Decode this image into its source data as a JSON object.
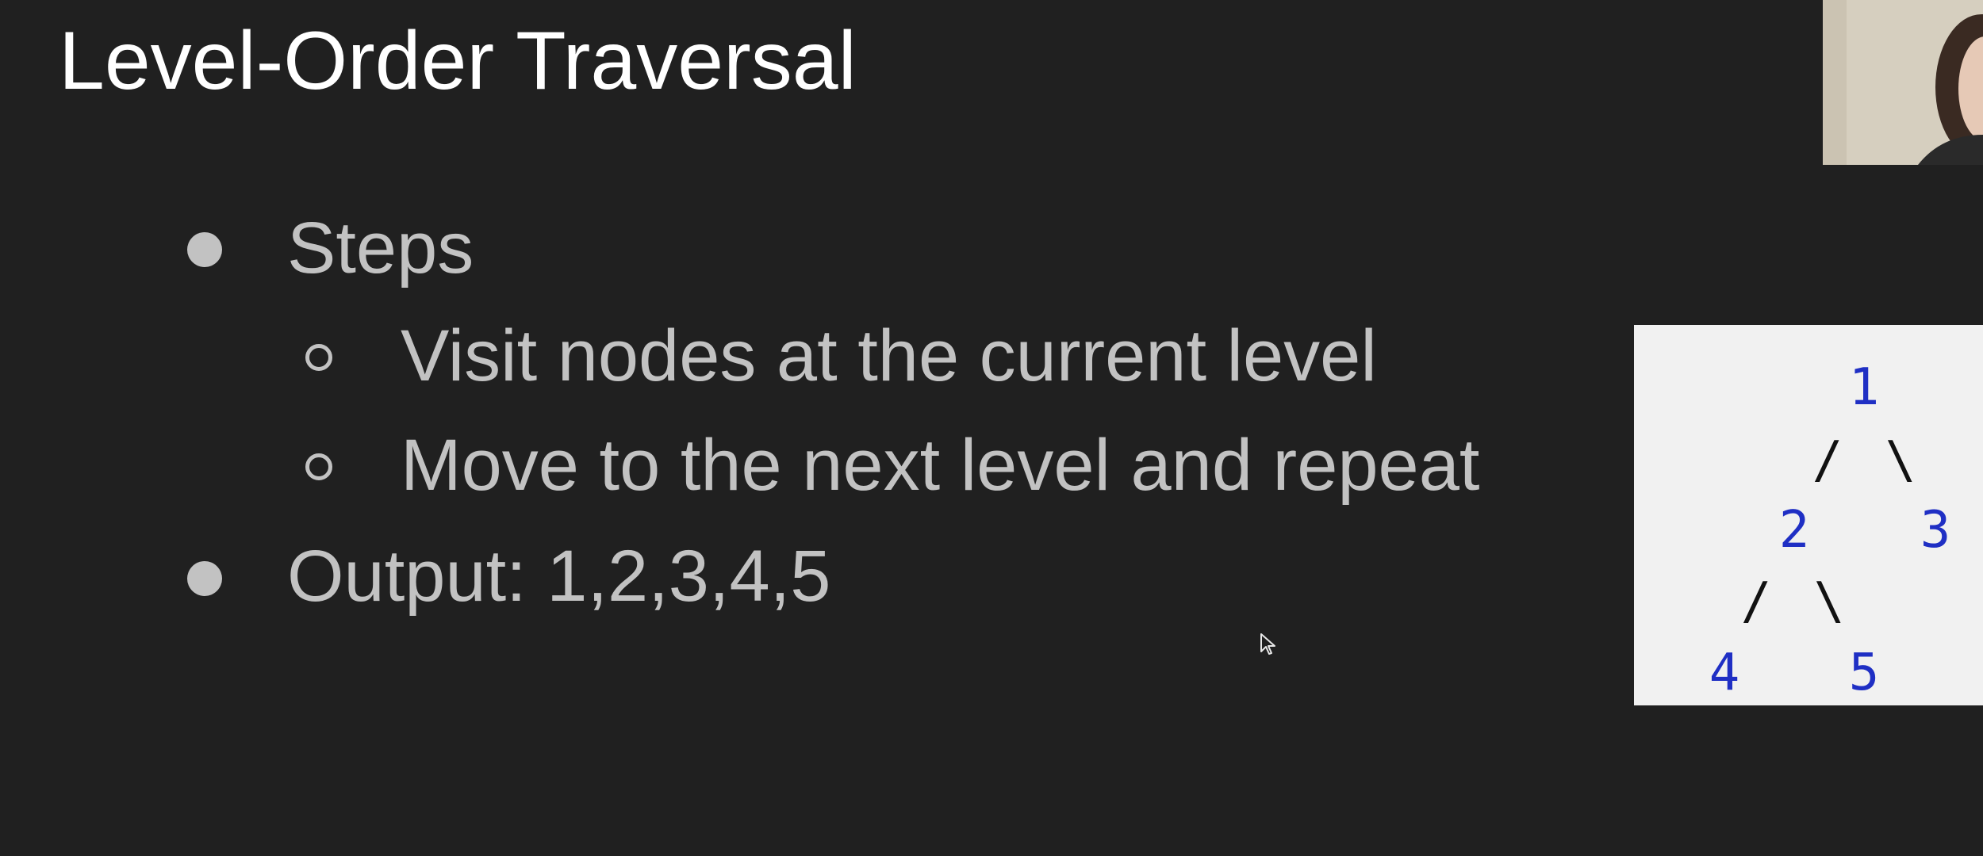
{
  "slide": {
    "title": "Level-Order Traversal",
    "bullets": [
      {
        "text": "Steps",
        "sub_bullets": [
          "Visit nodes at the current level",
          "Move to the next level and repeat"
        ]
      },
      {
        "text": "Output: 1,2,3,4,5"
      }
    ]
  },
  "tree_diagram": {
    "nodes": [
      "1",
      "2",
      "3",
      "4",
      "5"
    ],
    "edges": [
      "/",
      "\\",
      "/",
      "\\"
    ]
  },
  "colors": {
    "background": "#202020",
    "title": "#ffffff",
    "bullet_text": "#c2c2c2",
    "tree_panel": "#f1f1f1",
    "tree_node": "#1f2fc4",
    "tree_edge": "#111111"
  },
  "overlays": {
    "webcam": "presenter-webcam-thumbnail",
    "cursor": "mouse-pointer-icon"
  }
}
